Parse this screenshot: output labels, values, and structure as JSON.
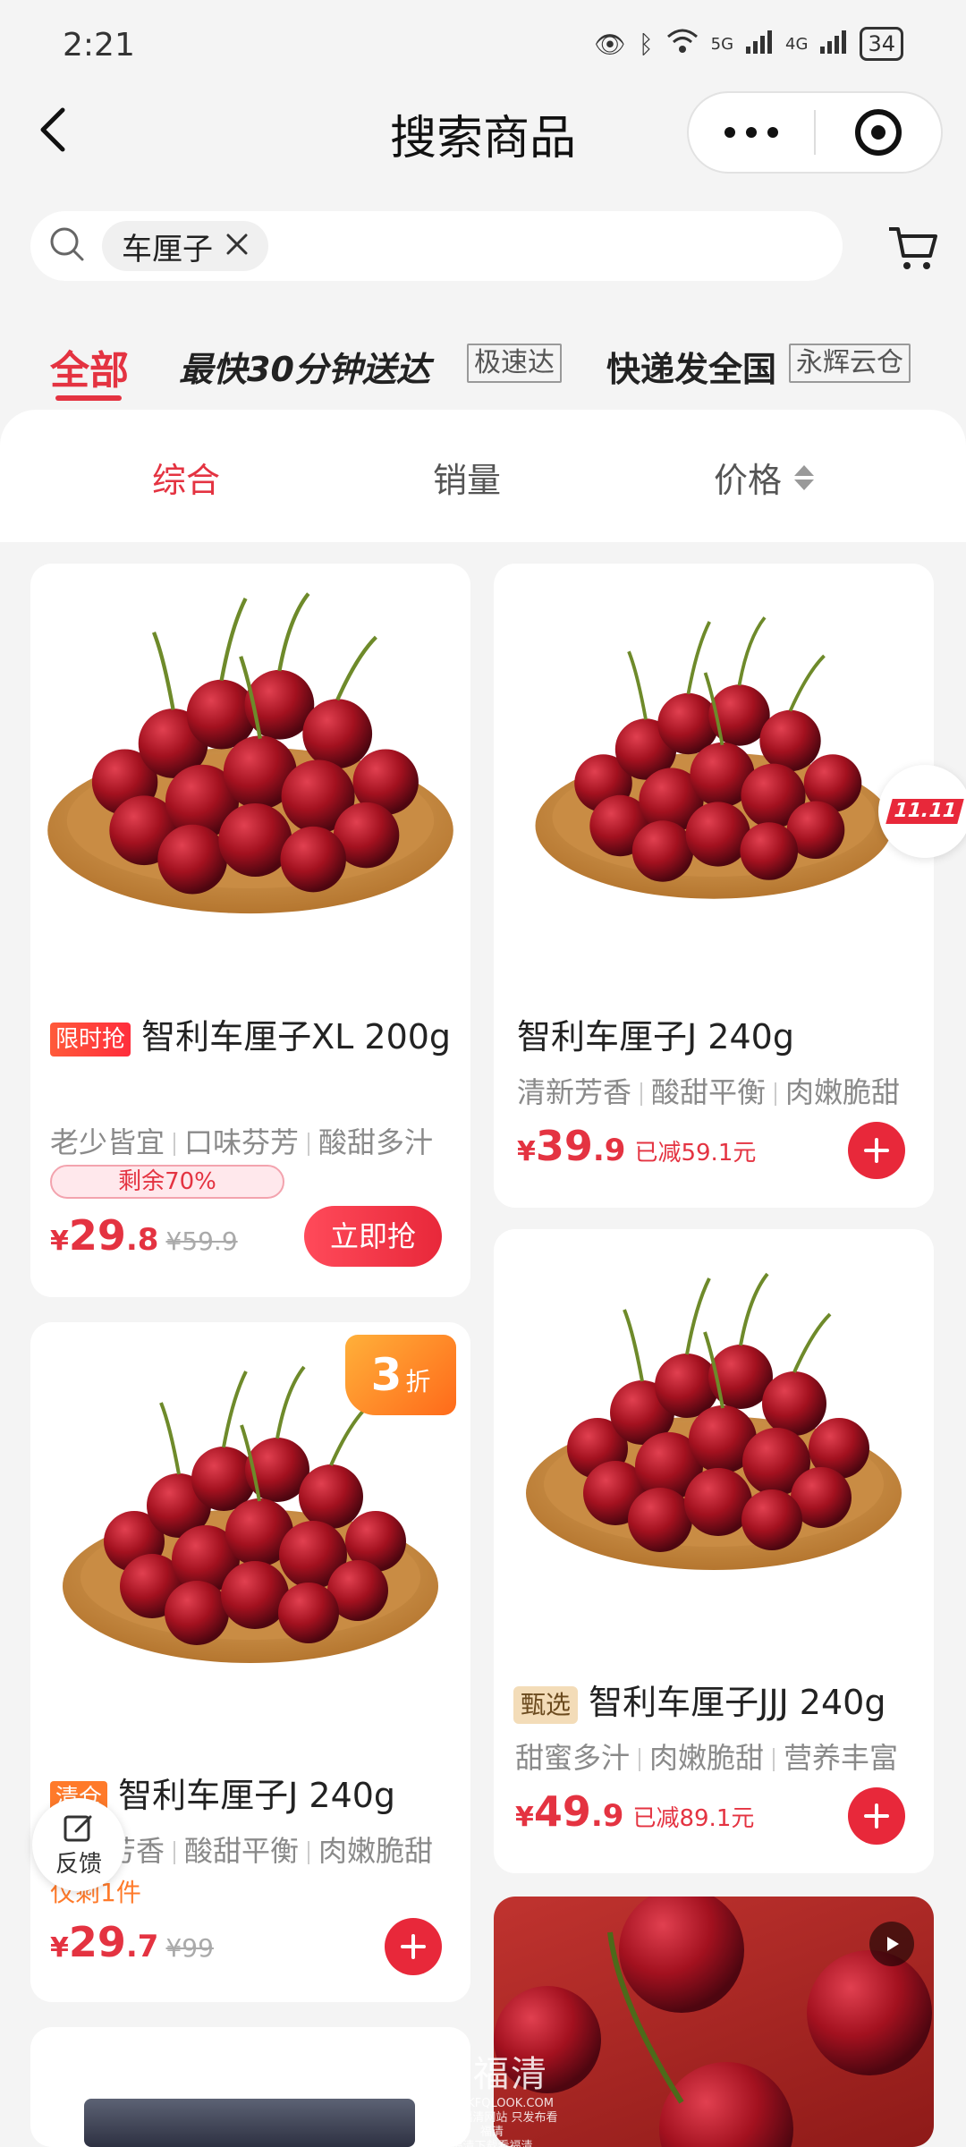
{
  "status_bar": {
    "time": "2:21",
    "network_a": "5G",
    "network_b": "4G",
    "battery": "34"
  },
  "header": {
    "title": "搜索商品"
  },
  "search": {
    "chip_text": "车厘子"
  },
  "categories": {
    "all": "全部",
    "fast": "最快30分钟送达",
    "fast_tag": "极速达",
    "express": "快递发全国",
    "express_tag": "永辉云仓"
  },
  "sort": {
    "comprehensive": "综合",
    "sales": "销量",
    "price": "价格"
  },
  "products": [
    {
      "badge": "限时抢",
      "title": "智利车厘子XL 200g",
      "features": [
        "老少皆宜",
        "口味芬芳",
        "酸甜多汁"
      ],
      "remaining": "剩余70%",
      "price_currency": "¥",
      "price_int": "29",
      "price_dec": ".8",
      "old_price": "¥59.9",
      "button": "立即抢"
    },
    {
      "title": "智利车厘子J 240g",
      "features": [
        "清新芳香",
        "酸甜平衡",
        "肉嫩脆甜"
      ],
      "price_currency": "¥",
      "price_int": "39",
      "price_dec": ".9",
      "saved": "已减59.1元"
    },
    {
      "discount_num": "3",
      "discount_unit": "折",
      "badge": "清仓",
      "title": "智利车厘子J 240g",
      "features": [
        "清新芳香",
        "酸甜平衡",
        "肉嫩脆甜"
      ],
      "stock_note": "仅剩1件",
      "price_currency": "¥",
      "price_int": "29",
      "price_dec": ".7",
      "old_price": "¥99"
    },
    {
      "badge": "甄选",
      "title": "智利车厘子JJJ 240g",
      "features": [
        "甜蜜多汁",
        "肉嫩脆甜",
        "营养丰富"
      ],
      "price_currency": "¥",
      "price_int": "49",
      "price_dec": ".9",
      "saved": "已减89.1元"
    }
  ],
  "floating": {
    "feedback": "反馈",
    "promo": "11.11"
  },
  "watermark": {
    "main": "看福清",
    "site": "WWW.KFQLOOK.COM",
    "line1": "手机看福清网站 只发布看福清",
    "line2": "福清下载看福清"
  },
  "colors": {
    "accent": "#e43341",
    "background": "#f4f4f4",
    "badge_orange": "#ff6a1a"
  },
  "icons": [
    "back-icon",
    "more-icon",
    "target-icon",
    "search-icon",
    "close-icon",
    "cart-icon",
    "plus-icon",
    "edit-icon",
    "video-icon"
  ]
}
